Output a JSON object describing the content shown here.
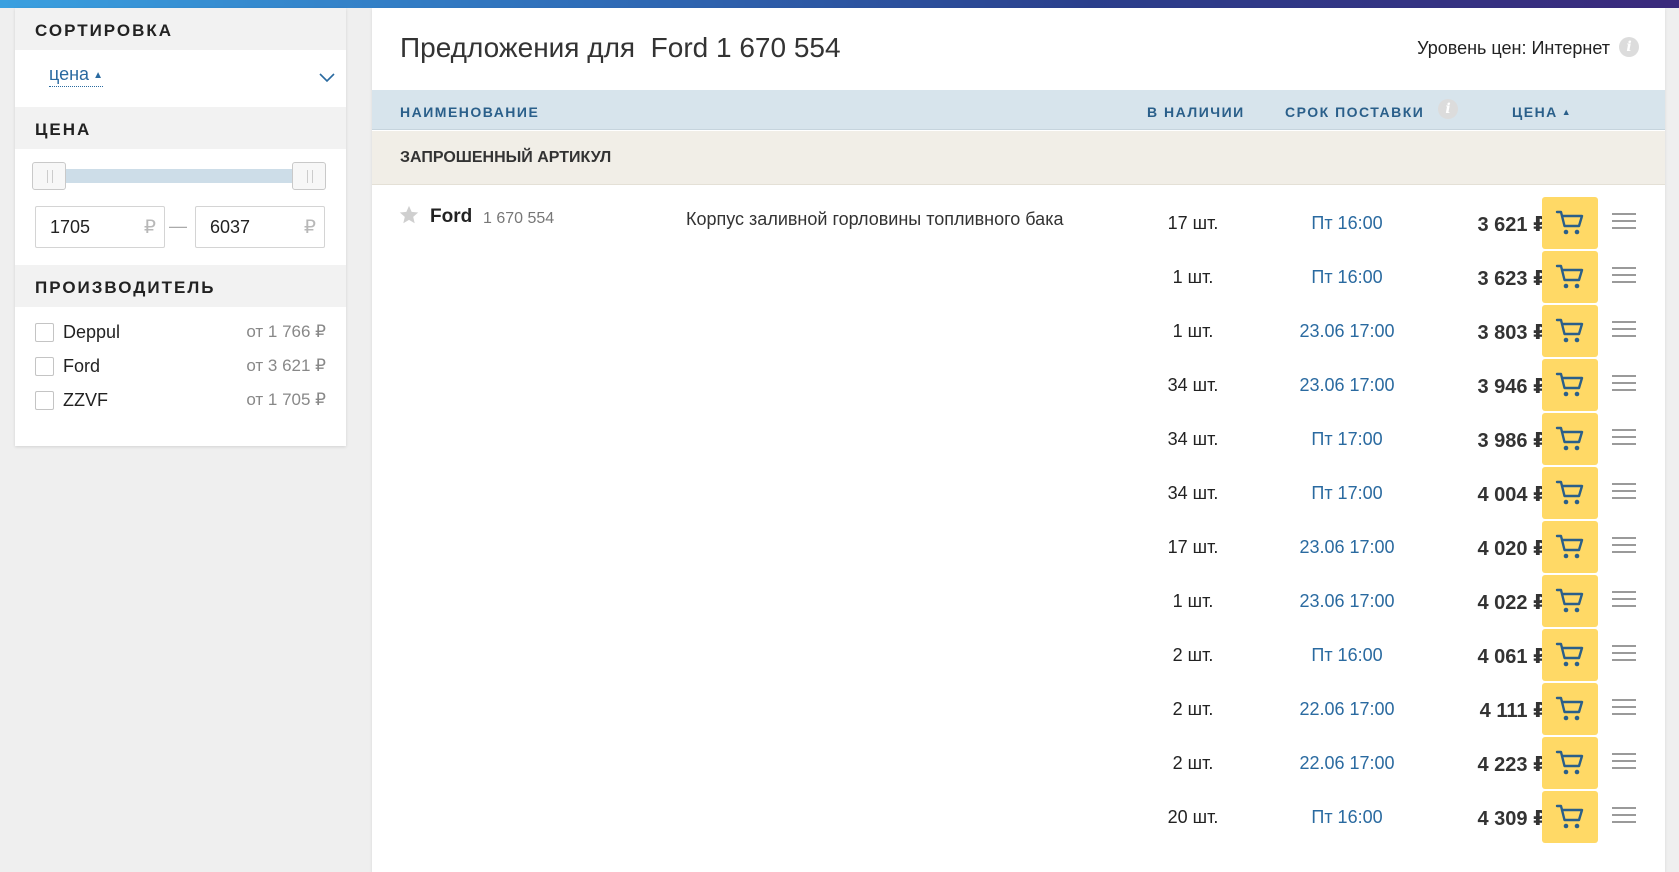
{
  "sidebar": {
    "sort": {
      "heading": "СОРТИРОВКА",
      "value": "цена",
      "caret": "▲"
    },
    "price": {
      "heading": "ЦЕНА",
      "min": "1705",
      "max": "6037",
      "currency": "₽",
      "dash": "—"
    },
    "manufacturer": {
      "heading": "ПРОИЗВОДИТЕЛЬ",
      "items": [
        {
          "name": "Deppul",
          "price": "от 1 766 ₽"
        },
        {
          "name": "Ford",
          "price": "от 3 621 ₽"
        },
        {
          "name": "ZZVF",
          "price": "от 1 705 ₽"
        }
      ]
    }
  },
  "main": {
    "title": "Предложения для  Ford 1 670 554",
    "price_level": "Уровень цен: Интернет",
    "info_glyph": "i",
    "columns": {
      "name": "НАИМЕНОВАНИЕ",
      "stock": "В НАЛИЧИИ",
      "delivery": "СРОК ПОСТАВКИ",
      "price": "ЦЕНА",
      "price_caret": "▲"
    },
    "section": "ЗАПРОШЕННЫЙ АРТИКУЛ",
    "product": {
      "brand": "Ford",
      "article": "1 670 554",
      "description": "Корпус заливной горловины топливного бака"
    },
    "offers": [
      {
        "qty": "17 шт.",
        "delivery": "Пт 16:00",
        "price": "3 621 ₽"
      },
      {
        "qty": "1 шт.",
        "delivery": "Пт 16:00",
        "price": "3 623 ₽"
      },
      {
        "qty": "1 шт.",
        "delivery": "23.06 17:00",
        "price": "3 803 ₽"
      },
      {
        "qty": "34 шт.",
        "delivery": "23.06 17:00",
        "price": "3 946 ₽"
      },
      {
        "qty": "34 шт.",
        "delivery": "Пт 17:00",
        "price": "3 986 ₽"
      },
      {
        "qty": "34 шт.",
        "delivery": "Пт 17:00",
        "price": "4 004 ₽"
      },
      {
        "qty": "17 шт.",
        "delivery": "23.06 17:00",
        "price": "4 020 ₽"
      },
      {
        "qty": "1 шт.",
        "delivery": "23.06 17:00",
        "price": "4 022 ₽"
      },
      {
        "qty": "2 шт.",
        "delivery": "Пт 16:00",
        "price": "4 061 ₽"
      },
      {
        "qty": "2 шт.",
        "delivery": "22.06 17:00",
        "price": "4 111 ₽"
      },
      {
        "qty": "2 шт.",
        "delivery": "22.06 17:00",
        "price": "4 223 ₽"
      },
      {
        "qty": "20 шт.",
        "delivery": "Пт 16:00",
        "price": "4 309 ₽"
      }
    ]
  },
  "colors": {
    "accent_blue": "#2a6aa0",
    "header_bg": "#d7e4ec",
    "cart_yellow": "#ffd966",
    "section_bg": "#f1eee7"
  },
  "icons": {
    "sort_dropdown": "chevron-down-icon",
    "info": "info-icon",
    "favorite": "star-icon",
    "cart": "cart-icon",
    "row_menu": "menu-icon"
  }
}
